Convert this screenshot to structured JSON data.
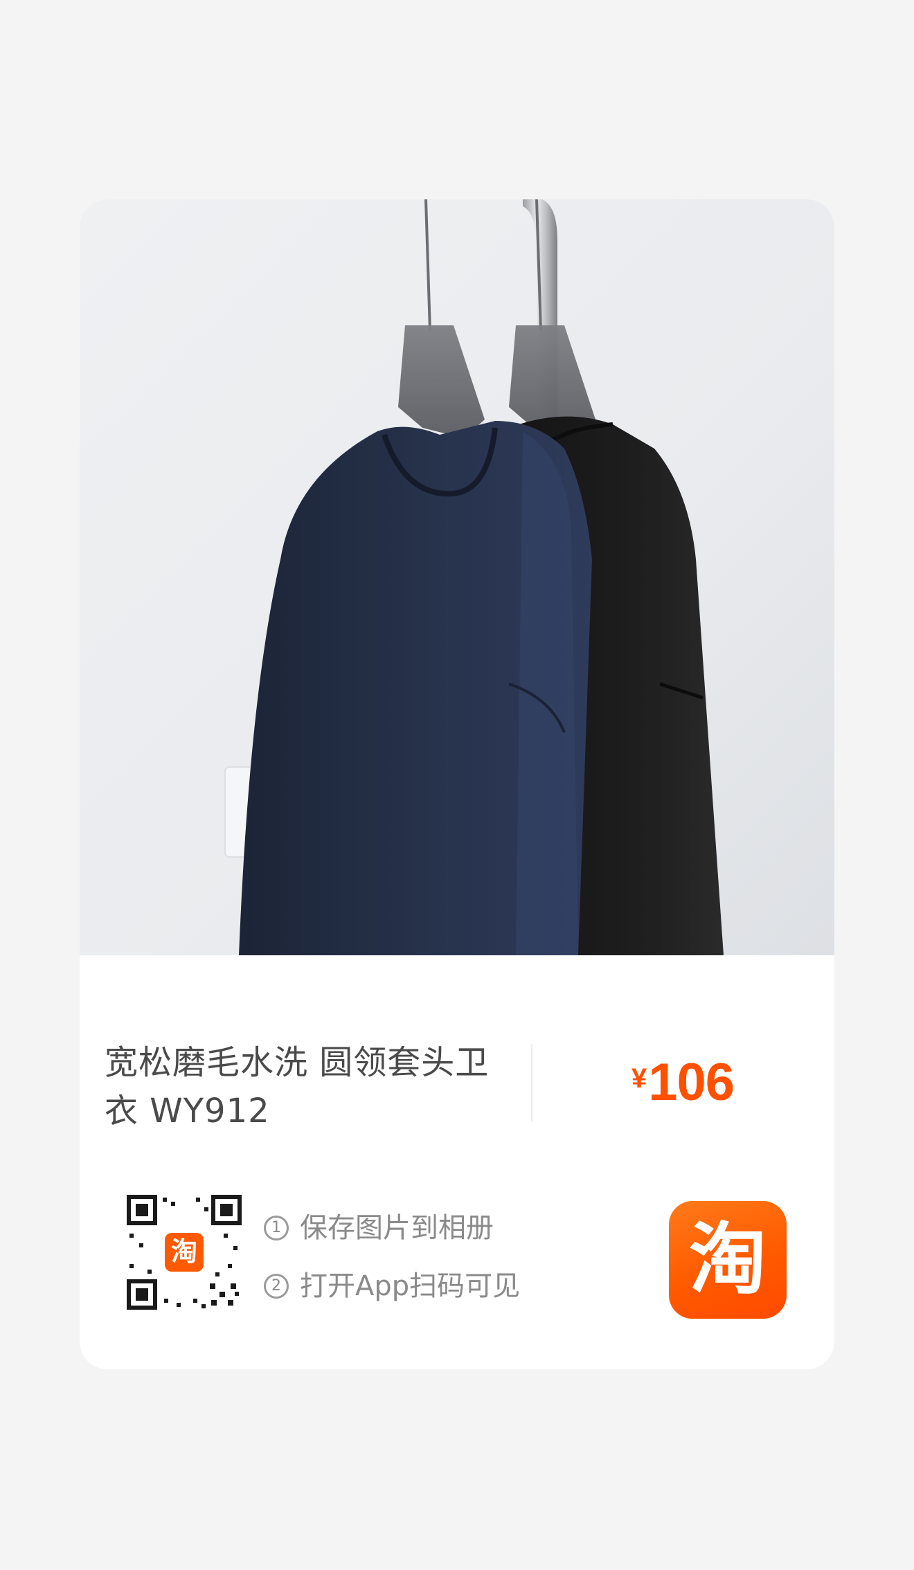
{
  "product": {
    "title": "宽松磨毛水洗 圆领套头卫衣 WY912",
    "price_currency": "¥",
    "price_amount": "106"
  },
  "share": {
    "steps": [
      {
        "num": "1",
        "text": "保存图片到相册"
      },
      {
        "num": "2",
        "text": "打开App扫码可见"
      }
    ],
    "qr_badge_char": "淘",
    "app_icon_char": "淘"
  },
  "colors": {
    "price": "#ff5000",
    "brand_orange": "#ff5a00",
    "page_bg": "#f4f4f4"
  },
  "icons": {
    "qr": "qr-code-icon",
    "app": "taobao-app-icon"
  }
}
